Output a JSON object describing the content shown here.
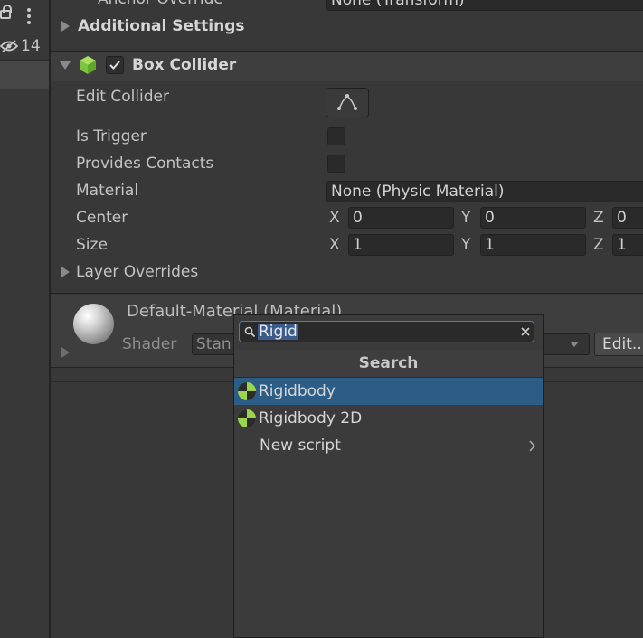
{
  "left_panel": {
    "visible_count": "14"
  },
  "inspector": {
    "anchor_override": {
      "label": "Anchor Override",
      "value": "None (Transform)"
    },
    "additional_settings": {
      "label": "Additional Settings"
    },
    "box_collider": {
      "title": "Box Collider",
      "enabled": true,
      "edit_collider_label": "Edit Collider",
      "is_trigger_label": "Is Trigger",
      "provides_contacts_label": "Provides Contacts",
      "material_label": "Material",
      "material_value": "None (Physic Material)",
      "center_label": "Center",
      "center": {
        "x": "0",
        "y": "0",
        "z": "0"
      },
      "size_label": "Size",
      "size": {
        "x": "1",
        "y": "1",
        "z": "1"
      },
      "axis_x": "X",
      "axis_y": "Y",
      "axis_z": "Z",
      "layer_overrides_label": "Layer Overrides"
    },
    "material_section": {
      "title": "Default-Material (Material)",
      "shader_label": "Shader",
      "shader_value": "Stan",
      "edit_button": "Edit..."
    }
  },
  "add_component_popup": {
    "search_value": "Rigid",
    "header": "Search",
    "items": [
      {
        "label": "Rigidbody",
        "selected": true,
        "icon": "rigidbody-icon"
      },
      {
        "label": "Rigidbody 2D",
        "selected": false,
        "icon": "rigidbody-icon"
      },
      {
        "label": "New script",
        "selected": false,
        "icon": "chevron-right-icon"
      }
    ]
  },
  "colors": {
    "background": "#383838",
    "selection": "#2c5d87",
    "rigidbody_icon": "#9bd64a",
    "box_collider_icon": "#8ed04a"
  }
}
